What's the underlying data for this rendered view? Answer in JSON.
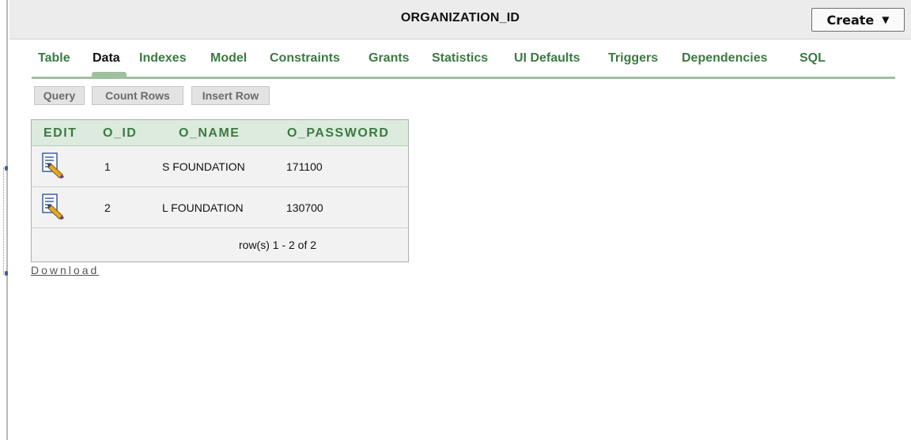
{
  "header": {
    "title": "ORGANIZATION_ID",
    "create_label": "Create",
    "create_caret": "▼"
  },
  "tabs": [
    {
      "label": "Table",
      "active": false
    },
    {
      "label": "Data",
      "active": true
    },
    {
      "label": "Indexes",
      "active": false
    },
    {
      "label": "Model",
      "active": false
    },
    {
      "label": "Constraints",
      "active": false
    },
    {
      "label": "Grants",
      "active": false
    },
    {
      "label": "Statistics",
      "active": false
    },
    {
      "label": "UI Defaults",
      "active": false
    },
    {
      "label": "Triggers",
      "active": false
    },
    {
      "label": "Dependencies",
      "active": false
    },
    {
      "label": "SQL",
      "active": false
    }
  ],
  "actions": {
    "query": "Query",
    "count_rows": "Count Rows",
    "insert_row": "Insert Row"
  },
  "grid": {
    "columns": [
      "EDIT",
      "O_ID",
      "O_NAME",
      "O_PASSWORD"
    ],
    "rows": [
      {
        "o_id": "1",
        "o_name": "S FOUNDATION",
        "o_password": "171100",
        "edit_icon": "edit-record-icon"
      },
      {
        "o_id": "2",
        "o_name": "L FOUNDATION",
        "o_password": "130700",
        "edit_icon": "edit-record-icon"
      }
    ],
    "row_count": "row(s) 1 - 2 of 2"
  },
  "download_label": "Download",
  "colors": {
    "tab_green": "#3b7a43",
    "header_bg": "#ececec",
    "grid_header_bg": "#dcebdd"
  }
}
